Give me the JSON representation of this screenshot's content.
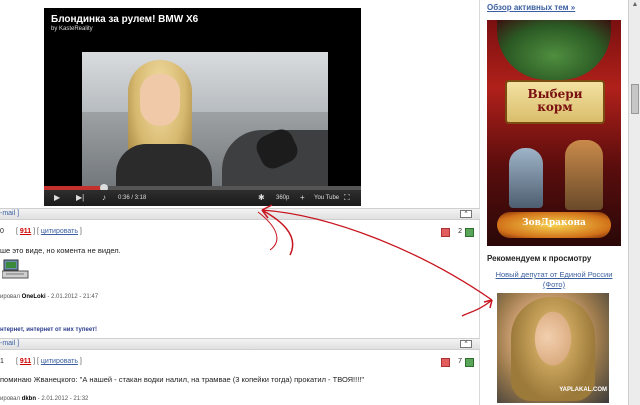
{
  "video": {
    "title": "Блондинка за рулем! BMW X6",
    "channel": "by KasteReality",
    "time": "0:36 / 3:18",
    "progress": 0.19,
    "play_icon": "▶",
    "next_icon": "▶|",
    "volume_icon": "♪",
    "settings_icon": "✱",
    "quality": "360p",
    "add_icon": "+",
    "youtube_label": "You Tube",
    "fullscreen_icon": "⛶"
  },
  "posts": [
    {
      "bar_text": "-mail ]",
      "num": "0",
      "rating": "911",
      "cite": "цитировать",
      "votes": "2",
      "text": "ше это виде, но комента не видел.",
      "author_prefix": "ировал",
      "author": "OneLoki",
      "date": "- 2.01.2012 - 21:47",
      "signature": "нтернет, интернет от них тупеет!"
    },
    {
      "bar_text": "-mail ]",
      "num": "1",
      "rating": "911",
      "cite": "цитировать",
      "votes": "7",
      "text": "поминаю Жванецкого: \"А нашей - стакан водки налил, на трамвае (3 копейки тогда) прокатил - ТВОЯ!!!!\"",
      "author_prefix": "ировал",
      "author": "dkbn",
      "date": "- 2.01.2012 - 21:32"
    }
  ],
  "sidebar": {
    "top_link": "Обзор активных тем »",
    "ad_text_line1": "Выбери",
    "ad_text_line2": "корм",
    "ad_logo": "ЗовДракона",
    "rec_title": "Рекомендуем к просмотру",
    "rec_link": "Новый депутат от Единой России (Фото)",
    "watermark": "YAPLAKAL.COM"
  },
  "colors": {
    "link": "#3b5fa0",
    "rating": "#cc0000",
    "arrow": "#c8141e"
  }
}
